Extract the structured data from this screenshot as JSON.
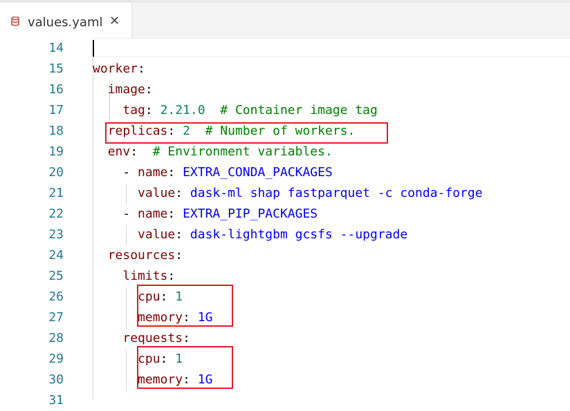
{
  "tab": {
    "filename": "values.yaml",
    "close_glyph": "✕",
    "icon": "database-icon"
  },
  "lines": [
    {
      "n": "14"
    },
    {
      "n": "15",
      "indent": "",
      "key": "worker",
      "sep": ":",
      "val": "",
      "vt": "",
      "com": ""
    },
    {
      "n": "16",
      "indent": "  ",
      "key": "image",
      "sep": ":",
      "val": "",
      "vt": "",
      "com": ""
    },
    {
      "n": "17",
      "indent": "    ",
      "key": "tag",
      "sep": ": ",
      "val": "2.21.0",
      "vt": "num",
      "com": "  # Container image tag"
    },
    {
      "n": "18",
      "indent": "  ",
      "key": "replicas",
      "sep": ": ",
      "val": "2",
      "vt": "num",
      "com": "  # Number of workers."
    },
    {
      "n": "19",
      "indent": "  ",
      "key": "env",
      "sep": ":",
      "val": "",
      "vt": "",
      "com": "  # Environment variables."
    },
    {
      "n": "20",
      "indent": "    - ",
      "key": "name",
      "sep": ": ",
      "val": "EXTRA_CONDA_PACKAGES",
      "vt": "str",
      "com": ""
    },
    {
      "n": "21",
      "indent": "      ",
      "key": "value",
      "sep": ": ",
      "val": "dask-ml shap fastparquet -c conda-forge",
      "vt": "str",
      "com": ""
    },
    {
      "n": "22",
      "indent": "    - ",
      "key": "name",
      "sep": ": ",
      "val": "EXTRA_PIP_PACKAGES",
      "vt": "str",
      "com": ""
    },
    {
      "n": "23",
      "indent": "      ",
      "key": "value",
      "sep": ": ",
      "val": "dask-lightgbm gcsfs --upgrade",
      "vt": "str",
      "com": ""
    },
    {
      "n": "24",
      "indent": "  ",
      "key": "resources",
      "sep": ":",
      "val": "",
      "vt": "",
      "com": ""
    },
    {
      "n": "25",
      "indent": "    ",
      "key": "limits",
      "sep": ":",
      "val": "",
      "vt": "",
      "com": ""
    },
    {
      "n": "26",
      "indent": "      ",
      "key": "cpu",
      "sep": ": ",
      "val": "1",
      "vt": "num",
      "com": ""
    },
    {
      "n": "27",
      "indent": "      ",
      "key": "memory",
      "sep": ": ",
      "val": "1G",
      "vt": "str",
      "com": ""
    },
    {
      "n": "28",
      "indent": "    ",
      "key": "requests",
      "sep": ":",
      "val": "",
      "vt": "",
      "com": ""
    },
    {
      "n": "29",
      "indent": "      ",
      "key": "cpu",
      "sep": ": ",
      "val": "1",
      "vt": "num",
      "com": ""
    },
    {
      "n": "30",
      "indent": "      ",
      "key": "memory",
      "sep": ": ",
      "val": "1G",
      "vt": "str",
      "com": ""
    },
    {
      "n": "31"
    }
  ],
  "colors": {
    "key": "#800000",
    "number": "#098658",
    "string": "#0000ff",
    "comment": "#008000",
    "line_number": "#237893",
    "annotation_box": "#e31b23"
  }
}
